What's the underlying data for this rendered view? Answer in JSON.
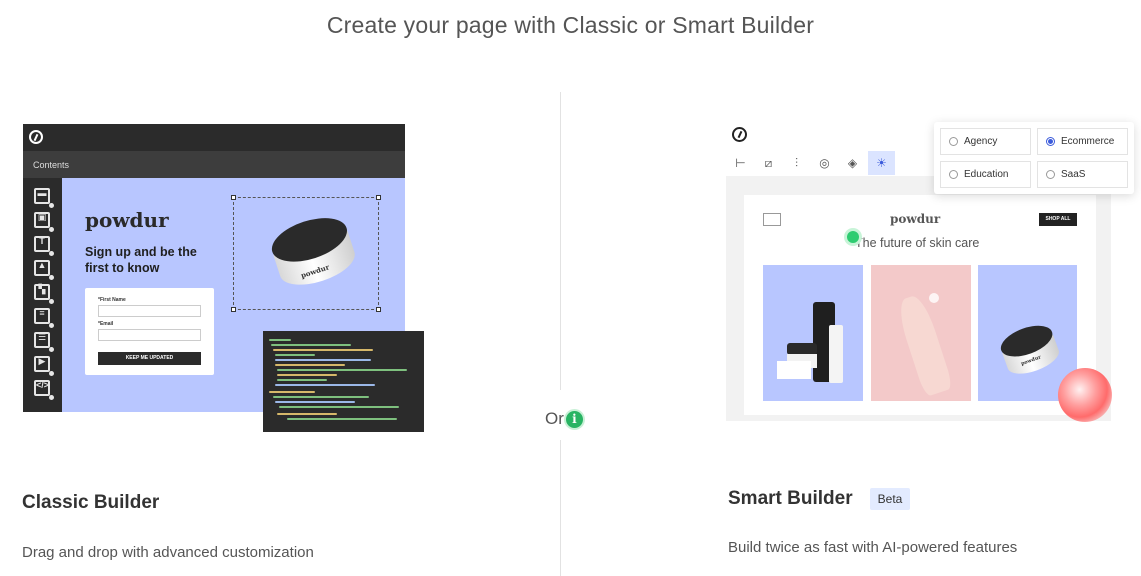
{
  "headline": "Create your page with Classic or Smart Builder",
  "separator": {
    "or_label": "Or",
    "info_icon": "info-icon"
  },
  "classic": {
    "title": "Classic Builder",
    "description": "Drag and drop with advanced customization",
    "mock": {
      "contents_label": "Contents",
      "brand": "powdur",
      "signup_line1": "Sign up and be the",
      "signup_line2": "first to know",
      "first_name_label": "*First Name",
      "email_label": "*Email",
      "button_label": "KEEP ME UPDATED",
      "product_label": "powdur",
      "tools": [
        "section-icon",
        "image-frame-icon",
        "text-icon",
        "image-icon",
        "image-text-icon",
        "list-icon",
        "form-icon",
        "video-icon",
        "code-icon"
      ]
    }
  },
  "smart": {
    "title": "Smart Builder",
    "badge": "Beta",
    "description": "Build twice as fast with AI-powered features",
    "mock": {
      "brand": "powdur",
      "tagline": "The future of skin care",
      "shop_button": "SHOP ALL",
      "product_label": "powdur",
      "toolbar_tools": [
        "sections-icon",
        "layout-icon",
        "sliders-icon",
        "target-icon",
        "theme-icon",
        "ideas-icon"
      ],
      "industries": [
        {
          "label": "Agency",
          "selected": false
        },
        {
          "label": "Ecommerce",
          "selected": true
        },
        {
          "label": "Education",
          "selected": false
        },
        {
          "label": "SaaS",
          "selected": false
        }
      ]
    }
  },
  "colors": {
    "classic_canvas": "#b8c6ff",
    "dark_chrome": "#2b2b2b",
    "accent_green": "#28b463",
    "beta_badge_bg": "#e3ebff",
    "selected_radio": "#3b5bdb"
  }
}
